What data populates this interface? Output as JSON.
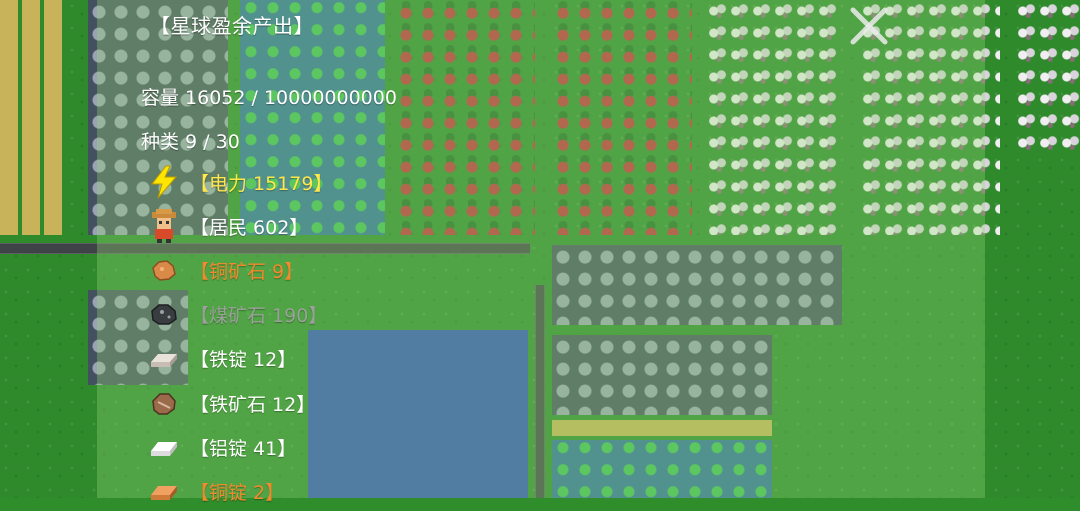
{
  "panel": {
    "title": "【星球盈余产出】",
    "capacity_text": "容量 16052 / 10000000000",
    "types_text": "种类 9 / 30",
    "close_label": "✕"
  },
  "items": [
    {
      "label": "【电力 15179】",
      "icon": "lightning-icon",
      "color": "#ffe84a"
    },
    {
      "label": "【居民 602】",
      "icon": "resident-icon",
      "color": "#ffffff"
    },
    {
      "label": "【铜矿石 9】",
      "icon": "copper-ore-icon",
      "color": "#f08a2c"
    },
    {
      "label": "【煤矿石 190】",
      "icon": "coal-ore-icon",
      "color": "#9aa09a"
    },
    {
      "label": "【铁锭 12】",
      "icon": "iron-ingot-icon",
      "color": "#ffffff"
    },
    {
      "label": "【铁矿石 12】",
      "icon": "iron-ore-icon",
      "color": "#ffffff"
    },
    {
      "label": "【铝锭 41】",
      "icon": "aluminum-ingot-icon",
      "color": "#ffffff"
    },
    {
      "label": "【铜锭 2】",
      "icon": "copper-ingot-icon",
      "color": "#f08a2c"
    }
  ]
}
